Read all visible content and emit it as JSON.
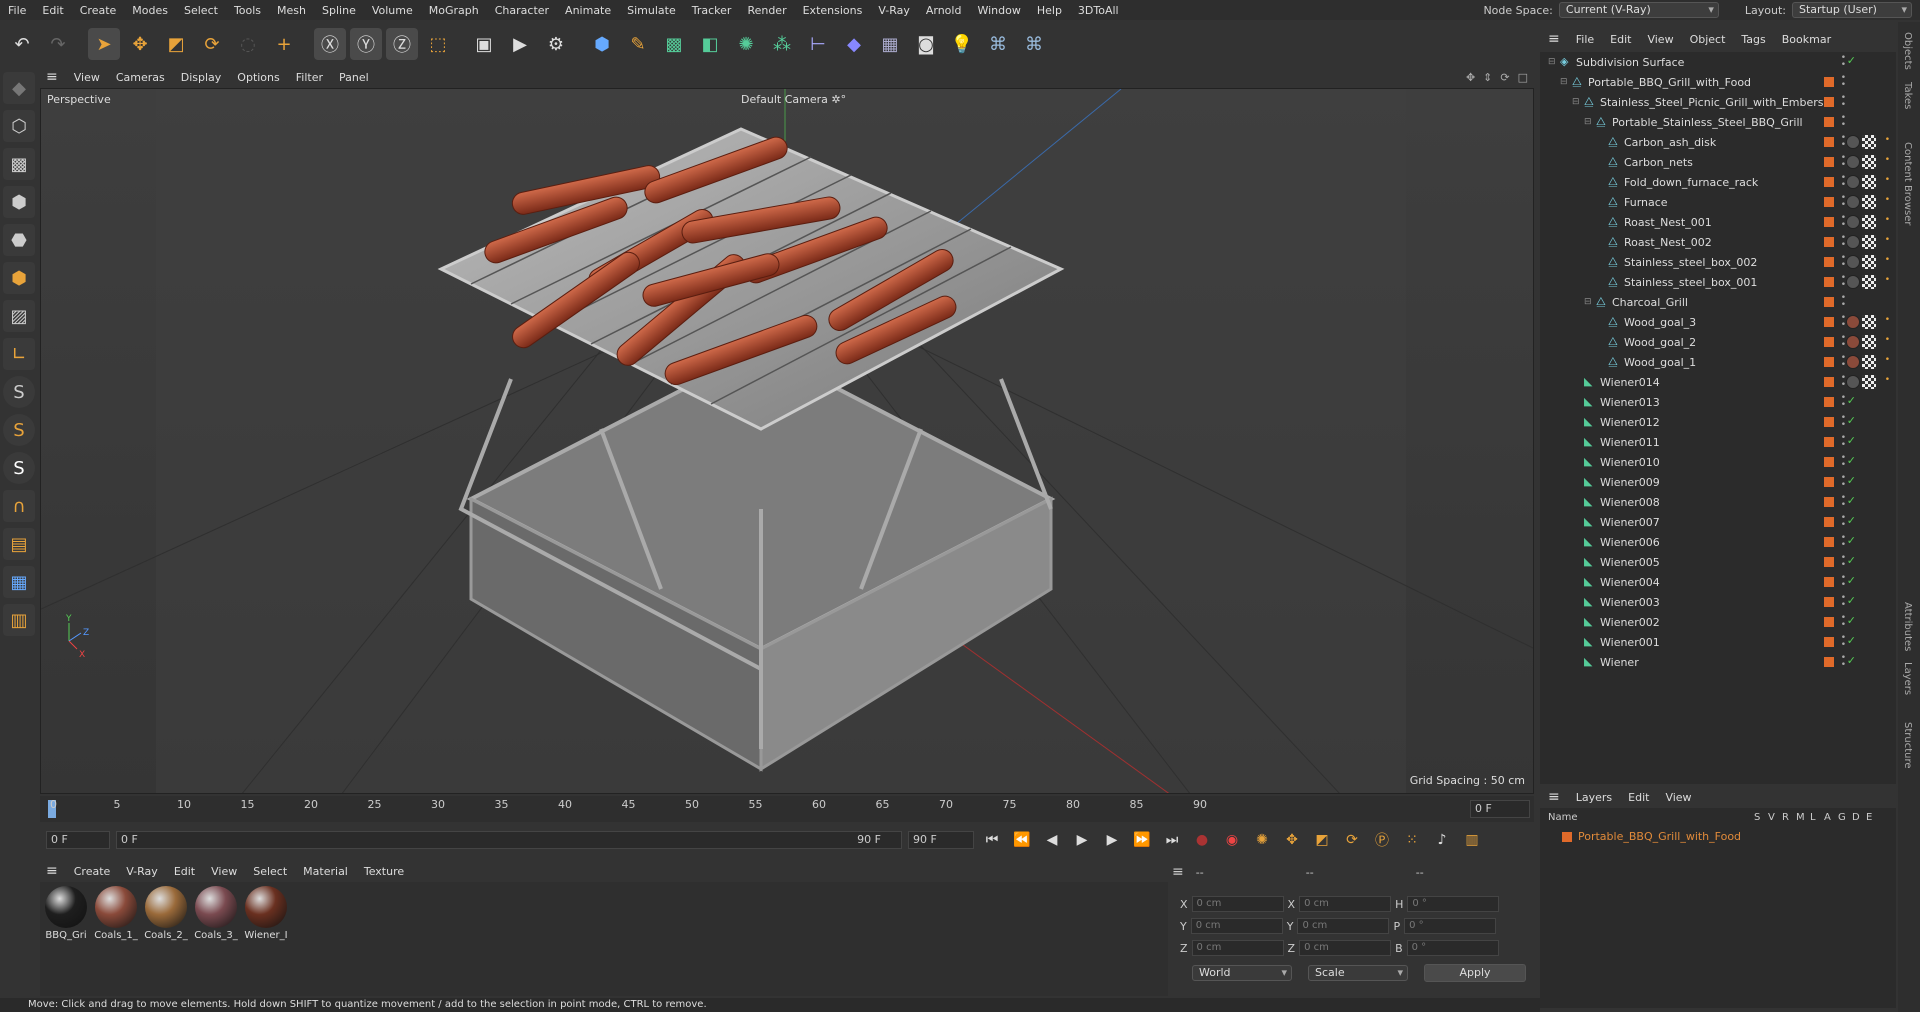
{
  "menubar": {
    "items": [
      "File",
      "Edit",
      "Create",
      "Modes",
      "Select",
      "Tools",
      "Mesh",
      "Spline",
      "Volume",
      "MoGraph",
      "Character",
      "Animate",
      "Simulate",
      "Tracker",
      "Render",
      "Extensions",
      "V-Ray",
      "Arnold",
      "Window",
      "Help",
      "3DToAll"
    ],
    "node_space_label": "Node Space:",
    "node_space_value": "Current (V-Ray)",
    "layout_label": "Layout:",
    "layout_value": "Startup (User)"
  },
  "viewport": {
    "menu": [
      "View",
      "Cameras",
      "Display",
      "Options",
      "Filter",
      "Panel"
    ],
    "view_name": "Perspective",
    "camera": "Default Camera ✲°",
    "grid_spacing": "Grid Spacing : 50 cm"
  },
  "timeline": {
    "ticks": [
      "0",
      "5",
      "10",
      "15",
      "20",
      "25",
      "30",
      "35",
      "40",
      "45",
      "50",
      "55",
      "60",
      "65",
      "70",
      "75",
      "80",
      "85",
      "90"
    ],
    "current_frame": "0 F",
    "start": "0 F",
    "range_start": "0 F",
    "range_end": "90 F",
    "end": "90 F",
    "preview_end": "0 F"
  },
  "materials": {
    "menu": [
      "Create",
      "V-Ray",
      "Edit",
      "View",
      "Select",
      "Material",
      "Texture"
    ],
    "items": [
      {
        "name": "BBQ_Gri",
        "color": "#1e1e1e"
      },
      {
        "name": "Coals_1_",
        "color": "#8a4a3a"
      },
      {
        "name": "Coals_2_",
        "color": "#9a6a3a"
      },
      {
        "name": "Coals_3_",
        "color": "#7a4a50"
      },
      {
        "name": "Wiener_I",
        "color": "#6a3020"
      }
    ]
  },
  "coords": {
    "header": [
      "--",
      "--",
      "--"
    ],
    "x_label": "X",
    "y_label": "Y",
    "z_label": "Z",
    "h_label": "H",
    "p_label": "P",
    "b_label": "B",
    "pos_x": "0 cm",
    "pos_y": "0 cm",
    "pos_z": "0 cm",
    "size_x": "0 cm",
    "size_y": "0 cm",
    "size_z": "0 cm",
    "rot_h": "0 °",
    "rot_p": "0 °",
    "rot_b": "0 °",
    "mode": "World",
    "size_mode": "Scale",
    "apply": "Apply"
  },
  "status": "Move: Click and drag to move elements. Hold down SHIFT to quantize movement / add to the selection in point mode, CTRL to remove.",
  "objects": {
    "menu": [
      "File",
      "Edit",
      "View",
      "Object",
      "Tags",
      "Bookmar"
    ],
    "rows": [
      {
        "label": "Subdivision Surface",
        "indent": 0
      },
      {
        "label": "Portable_BBQ_Grill_with_Food",
        "indent": 1
      },
      {
        "label": "Stainless_Steel_Picnic_Grill_with_Embers",
        "indent": 2
      },
      {
        "label": "Portable_Stainless_Steel_BBQ_Grill",
        "indent": 3
      },
      {
        "label": "Carbon_ash_disk",
        "indent": 4
      },
      {
        "label": "Carbon_nets",
        "indent": 4
      },
      {
        "label": "Fold_down_furnace_rack",
        "indent": 4
      },
      {
        "label": "Furnace",
        "indent": 4
      },
      {
        "label": "Roast_Nest_001",
        "indent": 4
      },
      {
        "label": "Roast_Nest_002",
        "indent": 4
      },
      {
        "label": "Stainless_steel_box_002",
        "indent": 4
      },
      {
        "label": "Stainless_steel_box_001",
        "indent": 4
      },
      {
        "label": "Charcoal_Grill",
        "indent": 3
      },
      {
        "label": "Wood_goal_3",
        "indent": 4
      },
      {
        "label": "Wood_goal_2",
        "indent": 4
      },
      {
        "label": "Wood_goal_1",
        "indent": 4
      },
      {
        "label": "Wiener014",
        "indent": 2
      },
      {
        "label": "Wiener013",
        "indent": 2
      },
      {
        "label": "Wiener012",
        "indent": 2
      },
      {
        "label": "Wiener011",
        "indent": 2
      },
      {
        "label": "Wiener010",
        "indent": 2
      },
      {
        "label": "Wiener009",
        "indent": 2
      },
      {
        "label": "Wiener008",
        "indent": 2
      },
      {
        "label": "Wiener007",
        "indent": 2
      },
      {
        "label": "Wiener006",
        "indent": 2
      },
      {
        "label": "Wiener005",
        "indent": 2
      },
      {
        "label": "Wiener004",
        "indent": 2
      },
      {
        "label": "Wiener003",
        "indent": 2
      },
      {
        "label": "Wiener002",
        "indent": 2
      },
      {
        "label": "Wiener001",
        "indent": 2
      },
      {
        "label": "Wiener",
        "indent": 2
      }
    ]
  },
  "layers": {
    "menu": [
      "Layers",
      "Edit",
      "View"
    ],
    "columns": [
      "Name",
      "S",
      "V",
      "R",
      "M",
      "L",
      "A",
      "G",
      "D",
      "E"
    ],
    "row": "Portable_BBQ_Grill_with_Food"
  },
  "side_tabs": [
    "Objects",
    "Takes",
    "Content Browser",
    "Attributes",
    "Layers",
    "Structure"
  ]
}
